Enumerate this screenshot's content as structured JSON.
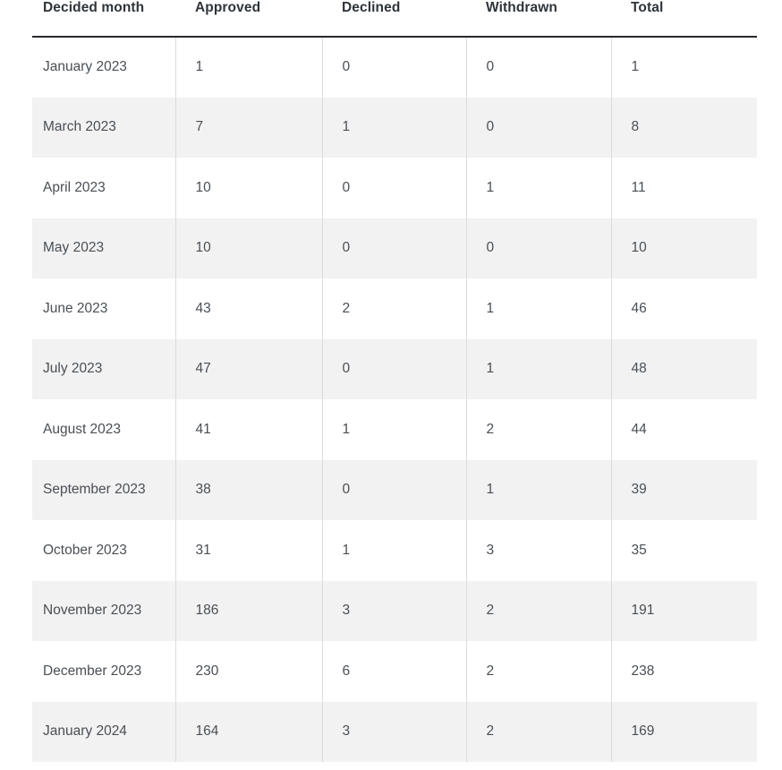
{
  "table": {
    "columns": [
      "Decided month",
      "Approved",
      "Declined",
      "Withdrawn",
      "Total"
    ],
    "rows": [
      {
        "month": "January 2023",
        "approved": "1",
        "declined": "0",
        "withdrawn": "0",
        "total": "1"
      },
      {
        "month": "March 2023",
        "approved": "7",
        "declined": "1",
        "withdrawn": "0",
        "total": "8"
      },
      {
        "month": "April 2023",
        "approved": "10",
        "declined": "0",
        "withdrawn": "1",
        "total": "11"
      },
      {
        "month": "May 2023",
        "approved": "10",
        "declined": "0",
        "withdrawn": "0",
        "total": "10"
      },
      {
        "month": "June 2023",
        "approved": "43",
        "declined": "2",
        "withdrawn": "1",
        "total": "46"
      },
      {
        "month": "July 2023",
        "approved": "47",
        "declined": "0",
        "withdrawn": "1",
        "total": "48"
      },
      {
        "month": "August 2023",
        "approved": "41",
        "declined": "1",
        "withdrawn": "2",
        "total": "44"
      },
      {
        "month": "September 2023",
        "approved": "38",
        "declined": "0",
        "withdrawn": "1",
        "total": "39"
      },
      {
        "month": "October 2023",
        "approved": "31",
        "declined": "1",
        "withdrawn": "3",
        "total": "35"
      },
      {
        "month": "November 2023",
        "approved": "186",
        "declined": "3",
        "withdrawn": "2",
        "total": "191"
      },
      {
        "month": "December 2023",
        "approved": "230",
        "declined": "6",
        "withdrawn": "2",
        "total": "238"
      },
      {
        "month": "January 2024",
        "approved": "164",
        "declined": "3",
        "withdrawn": "2",
        "total": "169"
      }
    ]
  },
  "chart_data": {
    "type": "table",
    "title": "",
    "categories": [
      "January 2023",
      "March 2023",
      "April 2023",
      "May 2023",
      "June 2023",
      "July 2023",
      "August 2023",
      "September 2023",
      "October 2023",
      "November 2023",
      "December 2023",
      "January 2024"
    ],
    "xlabel": "Decided month",
    "ylabel": "",
    "series": [
      {
        "name": "Approved",
        "values": [
          1,
          7,
          10,
          10,
          43,
          47,
          41,
          38,
          31,
          186,
          230,
          164
        ]
      },
      {
        "name": "Declined",
        "values": [
          0,
          1,
          0,
          0,
          2,
          0,
          1,
          0,
          1,
          3,
          6,
          3
        ]
      },
      {
        "name": "Withdrawn",
        "values": [
          0,
          0,
          1,
          0,
          1,
          1,
          2,
          1,
          3,
          2,
          2,
          2
        ]
      },
      {
        "name": "Total",
        "values": [
          1,
          8,
          11,
          10,
          46,
          48,
          44,
          39,
          35,
          191,
          238,
          169
        ]
      }
    ]
  },
  "style": {
    "header_text_color": "#2f3439",
    "body_text_color": "#4a4f54",
    "header_rule_color": "#25282c",
    "stripe_color": "#f2f2f2",
    "divider_color": "#dcdcdc",
    "background_color": "#ffffff"
  }
}
